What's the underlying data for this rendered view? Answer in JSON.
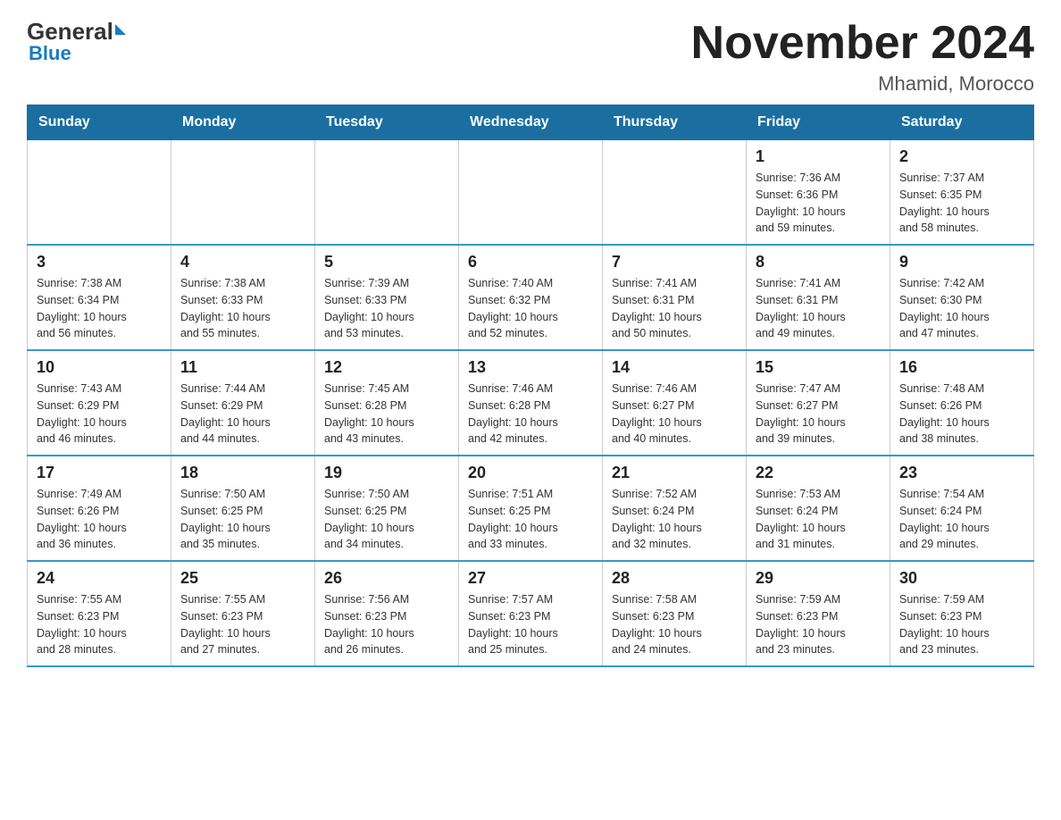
{
  "header": {
    "logo_general": "General",
    "logo_blue": "Blue",
    "month_title": "November 2024",
    "location": "Mhamid, Morocco"
  },
  "days_of_week": [
    "Sunday",
    "Monday",
    "Tuesday",
    "Wednesday",
    "Thursday",
    "Friday",
    "Saturday"
  ],
  "weeks": [
    [
      {
        "day": "",
        "info": ""
      },
      {
        "day": "",
        "info": ""
      },
      {
        "day": "",
        "info": ""
      },
      {
        "day": "",
        "info": ""
      },
      {
        "day": "",
        "info": ""
      },
      {
        "day": "1",
        "info": "Sunrise: 7:36 AM\nSunset: 6:36 PM\nDaylight: 10 hours\nand 59 minutes."
      },
      {
        "day": "2",
        "info": "Sunrise: 7:37 AM\nSunset: 6:35 PM\nDaylight: 10 hours\nand 58 minutes."
      }
    ],
    [
      {
        "day": "3",
        "info": "Sunrise: 7:38 AM\nSunset: 6:34 PM\nDaylight: 10 hours\nand 56 minutes."
      },
      {
        "day": "4",
        "info": "Sunrise: 7:38 AM\nSunset: 6:33 PM\nDaylight: 10 hours\nand 55 minutes."
      },
      {
        "day": "5",
        "info": "Sunrise: 7:39 AM\nSunset: 6:33 PM\nDaylight: 10 hours\nand 53 minutes."
      },
      {
        "day": "6",
        "info": "Sunrise: 7:40 AM\nSunset: 6:32 PM\nDaylight: 10 hours\nand 52 minutes."
      },
      {
        "day": "7",
        "info": "Sunrise: 7:41 AM\nSunset: 6:31 PM\nDaylight: 10 hours\nand 50 minutes."
      },
      {
        "day": "8",
        "info": "Sunrise: 7:41 AM\nSunset: 6:31 PM\nDaylight: 10 hours\nand 49 minutes."
      },
      {
        "day": "9",
        "info": "Sunrise: 7:42 AM\nSunset: 6:30 PM\nDaylight: 10 hours\nand 47 minutes."
      }
    ],
    [
      {
        "day": "10",
        "info": "Sunrise: 7:43 AM\nSunset: 6:29 PM\nDaylight: 10 hours\nand 46 minutes."
      },
      {
        "day": "11",
        "info": "Sunrise: 7:44 AM\nSunset: 6:29 PM\nDaylight: 10 hours\nand 44 minutes."
      },
      {
        "day": "12",
        "info": "Sunrise: 7:45 AM\nSunset: 6:28 PM\nDaylight: 10 hours\nand 43 minutes."
      },
      {
        "day": "13",
        "info": "Sunrise: 7:46 AM\nSunset: 6:28 PM\nDaylight: 10 hours\nand 42 minutes."
      },
      {
        "day": "14",
        "info": "Sunrise: 7:46 AM\nSunset: 6:27 PM\nDaylight: 10 hours\nand 40 minutes."
      },
      {
        "day": "15",
        "info": "Sunrise: 7:47 AM\nSunset: 6:27 PM\nDaylight: 10 hours\nand 39 minutes."
      },
      {
        "day": "16",
        "info": "Sunrise: 7:48 AM\nSunset: 6:26 PM\nDaylight: 10 hours\nand 38 minutes."
      }
    ],
    [
      {
        "day": "17",
        "info": "Sunrise: 7:49 AM\nSunset: 6:26 PM\nDaylight: 10 hours\nand 36 minutes."
      },
      {
        "day": "18",
        "info": "Sunrise: 7:50 AM\nSunset: 6:25 PM\nDaylight: 10 hours\nand 35 minutes."
      },
      {
        "day": "19",
        "info": "Sunrise: 7:50 AM\nSunset: 6:25 PM\nDaylight: 10 hours\nand 34 minutes."
      },
      {
        "day": "20",
        "info": "Sunrise: 7:51 AM\nSunset: 6:25 PM\nDaylight: 10 hours\nand 33 minutes."
      },
      {
        "day": "21",
        "info": "Sunrise: 7:52 AM\nSunset: 6:24 PM\nDaylight: 10 hours\nand 32 minutes."
      },
      {
        "day": "22",
        "info": "Sunrise: 7:53 AM\nSunset: 6:24 PM\nDaylight: 10 hours\nand 31 minutes."
      },
      {
        "day": "23",
        "info": "Sunrise: 7:54 AM\nSunset: 6:24 PM\nDaylight: 10 hours\nand 29 minutes."
      }
    ],
    [
      {
        "day": "24",
        "info": "Sunrise: 7:55 AM\nSunset: 6:23 PM\nDaylight: 10 hours\nand 28 minutes."
      },
      {
        "day": "25",
        "info": "Sunrise: 7:55 AM\nSunset: 6:23 PM\nDaylight: 10 hours\nand 27 minutes."
      },
      {
        "day": "26",
        "info": "Sunrise: 7:56 AM\nSunset: 6:23 PM\nDaylight: 10 hours\nand 26 minutes."
      },
      {
        "day": "27",
        "info": "Sunrise: 7:57 AM\nSunset: 6:23 PM\nDaylight: 10 hours\nand 25 minutes."
      },
      {
        "day": "28",
        "info": "Sunrise: 7:58 AM\nSunset: 6:23 PM\nDaylight: 10 hours\nand 24 minutes."
      },
      {
        "day": "29",
        "info": "Sunrise: 7:59 AM\nSunset: 6:23 PM\nDaylight: 10 hours\nand 23 minutes."
      },
      {
        "day": "30",
        "info": "Sunrise: 7:59 AM\nSunset: 6:23 PM\nDaylight: 10 hours\nand 23 minutes."
      }
    ]
  ]
}
